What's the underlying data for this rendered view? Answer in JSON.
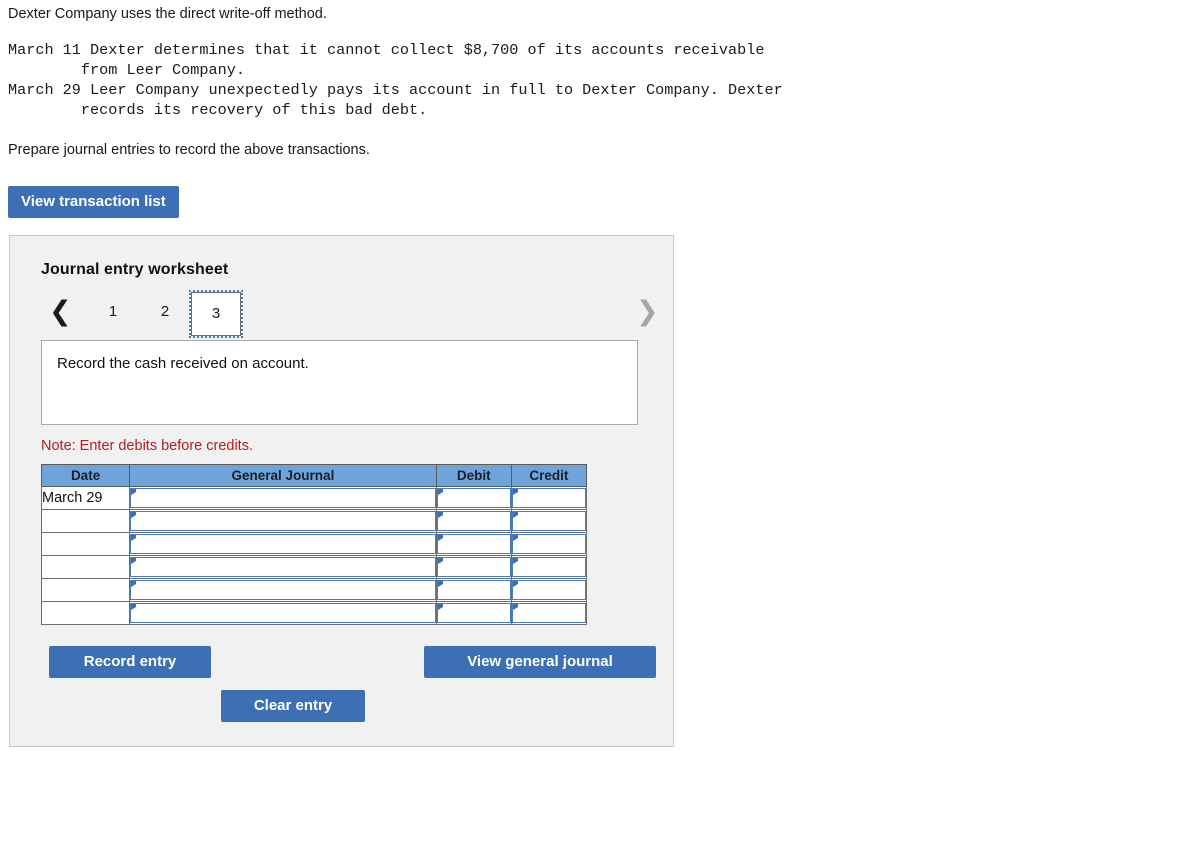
{
  "problem": {
    "intro": "Dexter Company uses the direct write-off method.",
    "transactions": "March 11 Dexter determines that it cannot collect $8,700 of its accounts receivable\n        from Leer Company.\nMarch 29 Leer Company unexpectedly pays its account in full to Dexter Company. Dexter\n        records its recovery of this bad debt.",
    "prepare": "Prepare journal entries to record the above transactions."
  },
  "toolbar": {
    "view_transaction_list": "View transaction list"
  },
  "worksheet": {
    "title": "Journal entry worksheet",
    "pager": {
      "prev_icon": "chevron-left-icon",
      "next_icon": "chevron-right-icon",
      "pages": [
        "1",
        "2",
        "3"
      ],
      "selected": "3"
    },
    "instruction": "Record the cash received on account.",
    "note": "Note: Enter debits before credits.",
    "table": {
      "columns": [
        "Date",
        "General Journal",
        "Debit",
        "Credit"
      ],
      "rows": [
        {
          "date": "March 29",
          "account": "",
          "debit": "",
          "credit": ""
        },
        {
          "date": "",
          "account": "",
          "debit": "",
          "credit": ""
        },
        {
          "date": "",
          "account": "",
          "debit": "",
          "credit": ""
        },
        {
          "date": "",
          "account": "",
          "debit": "",
          "credit": ""
        },
        {
          "date": "",
          "account": "",
          "debit": "",
          "credit": ""
        },
        {
          "date": "",
          "account": "",
          "debit": "",
          "credit": ""
        }
      ]
    },
    "actions": {
      "record_entry": "Record entry",
      "clear_entry": "Clear entry",
      "view_general_journal": "View general journal"
    }
  },
  "colors": {
    "button_blue": "#3d6fb4",
    "table_header_blue": "#6fa3da",
    "panel_gray": "#f1f1f1",
    "note_red": "#b02020",
    "field_border_blue": "#4a7ebb"
  }
}
